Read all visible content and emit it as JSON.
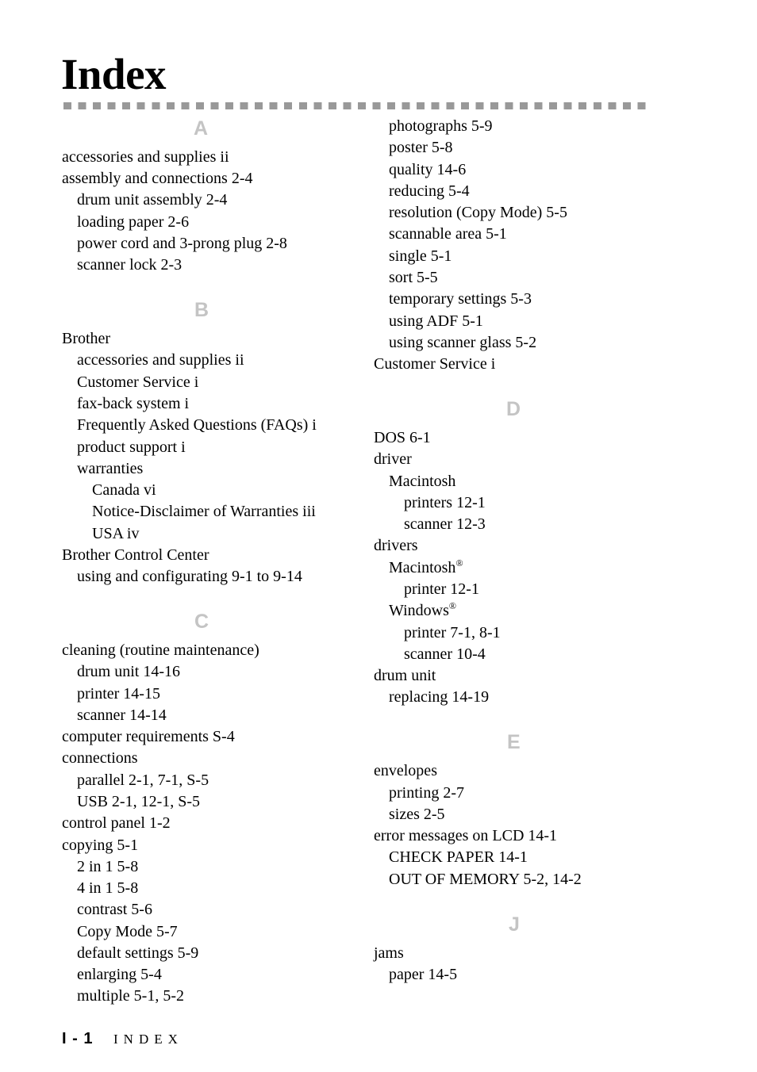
{
  "page": {
    "title": "Index",
    "footer": {
      "page_number": "I - 1",
      "section": "INDEX"
    }
  },
  "index": {
    "left_column": {
      "A": {
        "letter": "A",
        "entries": [
          "accessories and supplies ii",
          "assembly and connections 2-4",
          "drum unit assembly 2-4",
          "loading paper 2-6",
          "power cord and 3-prong plug 2-8",
          "scanner lock 2-3"
        ]
      },
      "B": {
        "letter": "B",
        "entries": [
          "Brother",
          "accessories and supplies ii",
          "Customer Service i",
          "fax-back system i",
          "Frequently Asked Questions (FAQs) i",
          "product support i",
          "warranties",
          "Canada vi",
          "Notice-Disclaimer of Warranties iii",
          "USA iv",
          "Brother Control Center",
          "using and configurating 9-1 to 9-14"
        ]
      },
      "C": {
        "letter": "C",
        "entries": [
          "cleaning (routine maintenance)",
          "drum unit 14-16",
          "printer 14-15",
          "scanner 14-14",
          "computer requirements S-4",
          "connections",
          "parallel 2-1, 7-1, S-5",
          "USB 2-1, 12-1, S-5",
          "control panel 1-2",
          "copying 5-1",
          "2 in 1 5-8",
          "4 in 1 5-8",
          "contrast 5-6",
          "Copy Mode 5-7",
          "default settings 5-9",
          "enlarging 5-4",
          "multiple 5-1, 5-2"
        ]
      }
    },
    "right_column": {
      "C_cont": {
        "entries": [
          "photographs 5-9",
          "poster 5-8",
          "quality 14-6",
          "reducing 5-4",
          "resolution (Copy Mode) 5-5",
          "scannable area 5-1",
          "single 5-1",
          "sort 5-5",
          "temporary settings 5-3",
          "using ADF 5-1",
          "using scanner glass 5-2",
          "Customer Service i"
        ]
      },
      "D": {
        "letter": "D",
        "entries": [
          "DOS 6-1",
          "driver",
          "Macintosh",
          "printers 12-1",
          "scanner 12-3",
          "drivers",
          "Macintosh",
          "printer 12-1",
          "Windows",
          "printer 7-1, 8-1",
          "scanner 10-4",
          "drum unit",
          "replacing 14-19"
        ],
        "registered_mark": "®"
      },
      "E": {
        "letter": "E",
        "entries": [
          "envelopes",
          "printing 2-7",
          "sizes 2-5",
          "error messages on LCD 14-1",
          "CHECK PAPER 14-1",
          "OUT OF MEMORY 5-2, 14-2"
        ]
      },
      "J": {
        "letter": "J",
        "entries": [
          "jams",
          "paper 14-5"
        ]
      }
    }
  }
}
